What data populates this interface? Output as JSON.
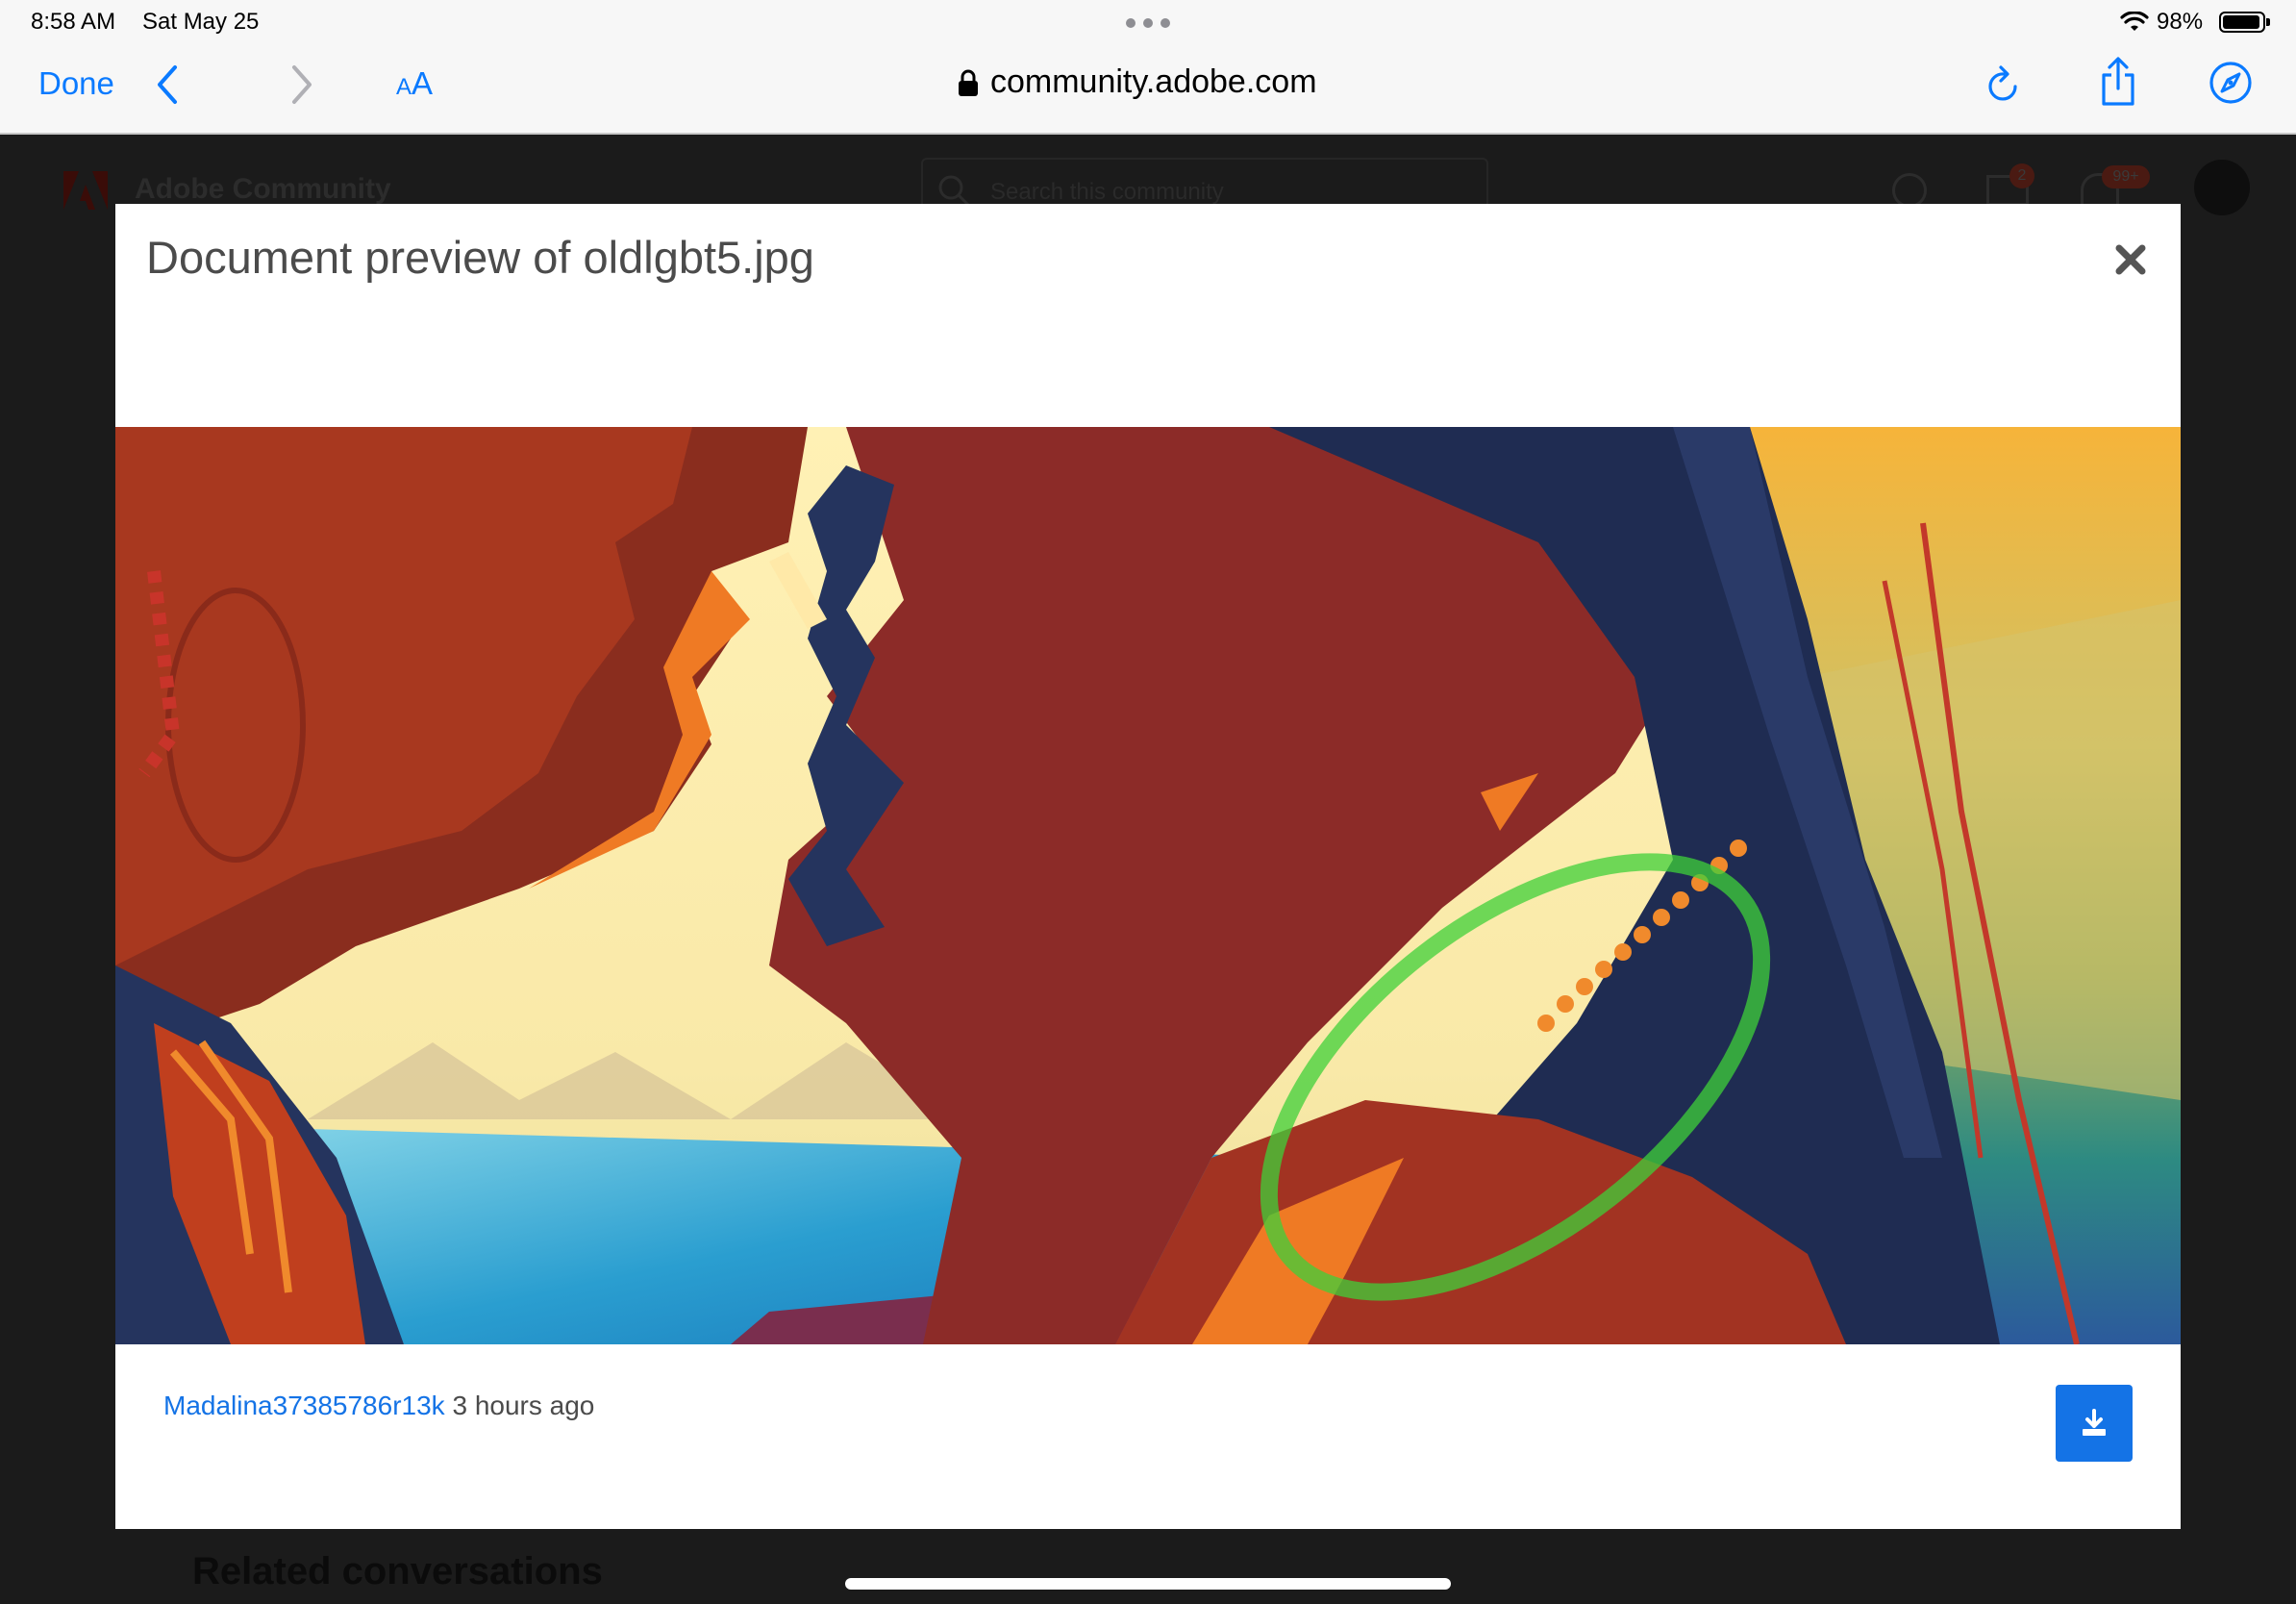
{
  "status_bar": {
    "time": "8:58 AM",
    "date": "Sat May 25",
    "battery_percent": "98%",
    "battery_level": 0.98
  },
  "browser": {
    "done_label": "Done",
    "aa_small": "A",
    "aa_big": "A",
    "url": "community.adobe.com",
    "accent_color": "#0a7aff"
  },
  "background_page": {
    "site_title": "Adobe Community",
    "search_placeholder": "Search this community",
    "mail_badge": "2",
    "notification_badge": "99+",
    "related_heading": "Related conversations"
  },
  "modal": {
    "title": "Document preview of oldlgbt5.jpg",
    "author": "Madalina37385786r13k",
    "time_ago": "3 hours ago",
    "download_color": "#1473e6",
    "close_icon": "close-icon",
    "download_icon": "download-icon"
  }
}
